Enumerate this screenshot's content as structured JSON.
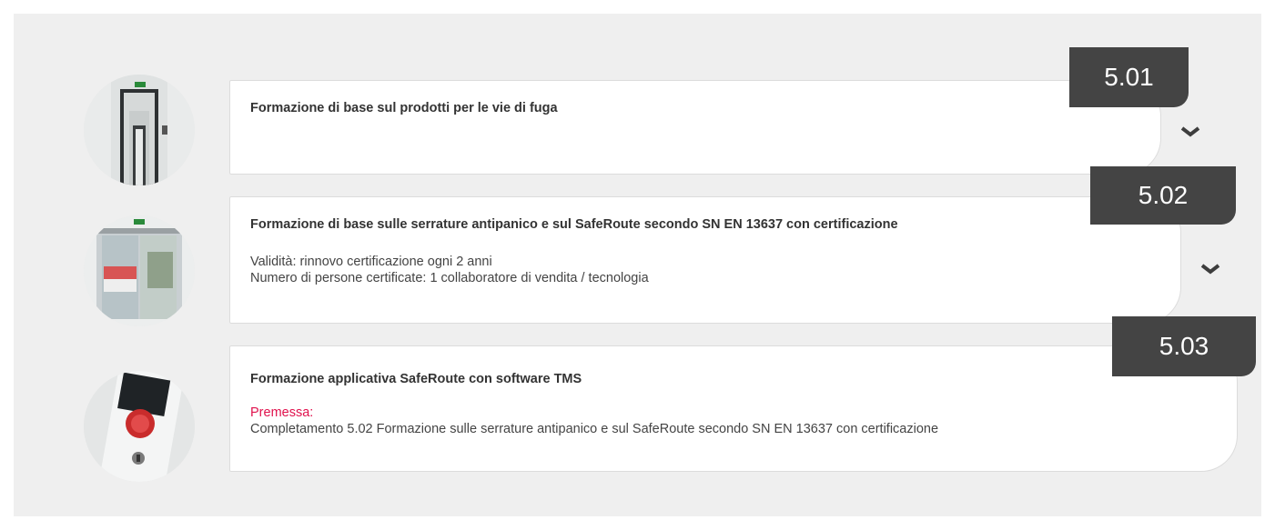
{
  "items": [
    {
      "badge": "5.01",
      "title": "Formazione di base sul prodotti per le vie di fuga",
      "image_icon": "emergency-exit-door-corridor",
      "expand_icon": "chevron-down-icon"
    },
    {
      "badge": "5.02",
      "title": "Formazione di base sulle serrature antipanico e sul SafeRoute secondo SN EN 13637 con certificazione",
      "lines": [
        "Validità: rinnovo certificazione ogni 2 anni",
        "Numero di persone certificate: 1 collaboratore di vendita / tecnologia"
      ],
      "image_icon": "automatic-sliding-door",
      "expand_icon": "chevron-down-icon"
    },
    {
      "badge": "5.03",
      "title": "Formazione applicativa SafeRoute con software TMS",
      "premessa_label": "Premessa:",
      "premessa_text": "Completamento 5.02 Formazione sulle serrature antipanico e sul SafeRoute secondo SN EN 13637 con certificazione",
      "image_icon": "emergency-button-keypad"
    }
  ],
  "colors": {
    "badge_bg": "#444444",
    "premessa": "#e0124d",
    "background": "#efefef"
  }
}
